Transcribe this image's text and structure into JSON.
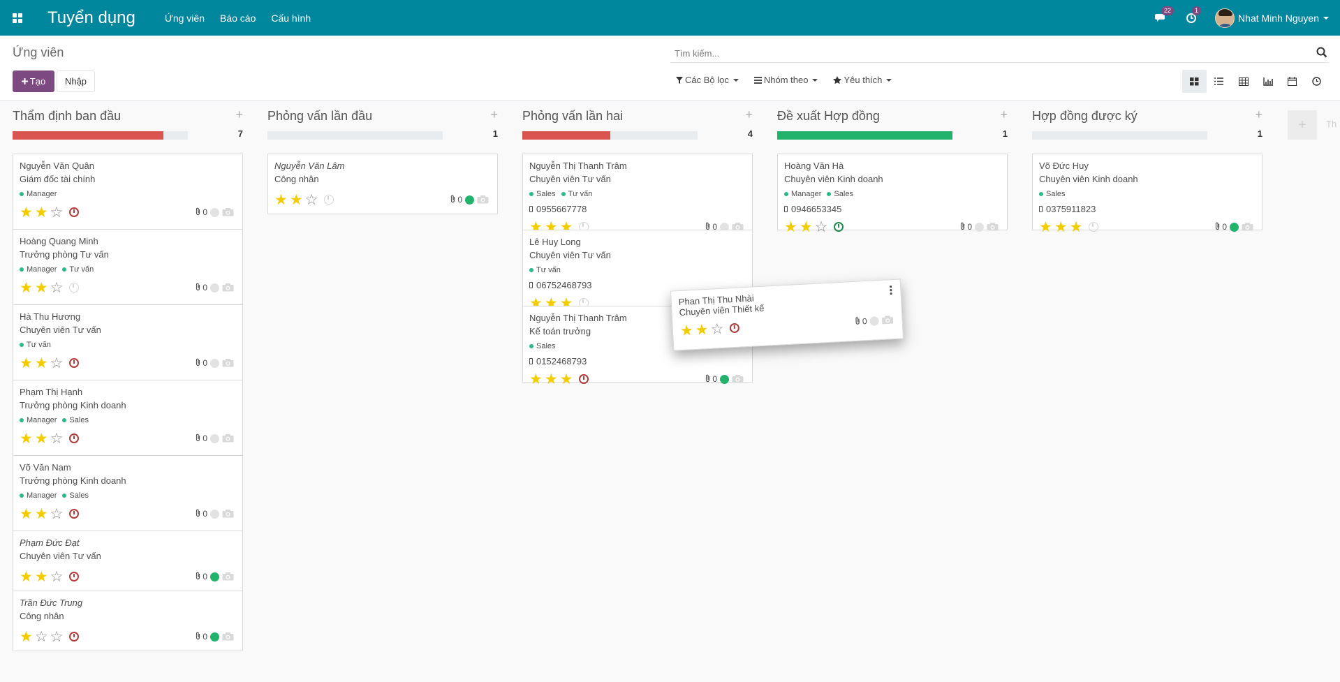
{
  "navbar": {
    "app_title": "Tuyển dụng",
    "menu": [
      "Ứng viên",
      "Báo cáo",
      "Cấu hình"
    ],
    "messages_count": "22",
    "activities_count": "1",
    "user_name": "Nhat Minh Nguyen"
  },
  "control": {
    "breadcrumb": "Ứng viên",
    "create_label": "Tạo",
    "import_label": "Nhập",
    "search_placeholder": "Tìm kiếm...",
    "filters_label": "Các Bộ lọc",
    "groupby_label": "Nhóm theo",
    "favorites_label": "Yêu thích"
  },
  "colors": {
    "navbar": "#00869d",
    "primary": "#7c4a80",
    "progress_red": "#d9534f",
    "progress_green": "#21b26b",
    "star": "#f3cc00",
    "tag_dot": "#2ab98b"
  },
  "columns": [
    {
      "title": "Thẩm định ban đầu",
      "count": "7",
      "progress": [
        {
          "color": "#d9534f",
          "percent": 86
        }
      ],
      "cards": [
        {
          "name": "Nguyễn Văn Quân",
          "italic": false,
          "job": "Giám đốc tài chính",
          "tags": [
            "Manager"
          ],
          "phone": "",
          "stars": 2,
          "activity": "red",
          "attachments": "0",
          "state": "grey"
        },
        {
          "name": "Hoàng Quang Minh",
          "italic": false,
          "job": "Trưởng phòng Tư vấn",
          "tags": [
            "Manager",
            "Tư vấn"
          ],
          "phone": "",
          "stars": 2,
          "activity": "grey",
          "attachments": "0",
          "state": "grey"
        },
        {
          "name": "Hà Thu Hương",
          "italic": false,
          "job": "Chuyên viên Tư vấn",
          "tags": [
            "Tư vấn"
          ],
          "phone": "",
          "stars": 2,
          "activity": "red",
          "attachments": "0",
          "state": "grey"
        },
        {
          "name": "Phạm Thị Hạnh",
          "italic": false,
          "job": "Trưởng phòng Kinh doanh",
          "tags": [
            "Manager",
            "Sales"
          ],
          "phone": "",
          "stars": 2,
          "activity": "red",
          "attachments": "0",
          "state": "grey"
        },
        {
          "name": "Võ Văn Nam",
          "italic": false,
          "job": "Trưởng phòng Kinh doanh",
          "tags": [
            "Manager",
            "Sales"
          ],
          "phone": "",
          "stars": 2,
          "activity": "red",
          "attachments": "0",
          "state": "grey"
        },
        {
          "name": "Phạm Đức Đạt",
          "italic": true,
          "job": "Chuyên viên Tư vấn",
          "tags": [],
          "phone": "",
          "stars": 2,
          "activity": "red",
          "attachments": "0",
          "state": "green"
        },
        {
          "name": "Trần Đức Trung",
          "italic": true,
          "job": "Công nhân",
          "tags": [],
          "phone": "",
          "stars": 1,
          "activity": "red",
          "attachments": "0",
          "state": "green"
        }
      ]
    },
    {
      "title": "Phỏng vấn lần đầu",
      "count": "1",
      "progress": [],
      "cards": [
        {
          "name": "Nguyễn Văn Lâm",
          "italic": true,
          "job": "Công nhân",
          "tags": [],
          "phone": "",
          "stars": 2,
          "activity": "grey",
          "attachments": "0",
          "state": "green"
        }
      ]
    },
    {
      "title": "Phỏng vấn lần hai",
      "count": "4",
      "progress": [
        {
          "color": "#d9534f",
          "percent": 50
        }
      ],
      "cards": [
        {
          "name": "Nguyễn Thị Thanh Trâm",
          "italic": false,
          "job": "Chuyên viên Tư vấn",
          "tags": [
            "Sales",
            "Tư vấn"
          ],
          "phone": "0955667778",
          "stars": 3,
          "activity": "grey",
          "attachments": "0",
          "state": "grey"
        },
        {
          "name": "Lê Huy Long",
          "italic": false,
          "job": "Chuyên viên Tư vấn",
          "tags": [
            "Tư vấn"
          ],
          "phone": "06752468793",
          "stars": 3,
          "activity": "grey",
          "attachments": "0",
          "state": "grey"
        },
        {
          "name": "Nguyễn Thị Thanh Trâm",
          "italic": false,
          "job": "Kế toán trưởng",
          "tags": [
            "Sales"
          ],
          "phone": "0152468793",
          "stars": 3,
          "activity": "red",
          "attachments": "0",
          "state": "green"
        }
      ]
    },
    {
      "title": "Đề xuất Hợp đồng",
      "count": "1",
      "progress": [
        {
          "color": "#21b26b",
          "percent": 100
        }
      ],
      "cards": [
        {
          "name": "Hoàng Văn Hà",
          "italic": false,
          "job": "Chuyên viên Kinh doanh",
          "tags": [
            "Manager",
            "Sales"
          ],
          "phone": "0946653345",
          "stars": 2,
          "activity": "green",
          "attachments": "0",
          "state": "grey"
        }
      ]
    },
    {
      "title": "Hợp đồng được ký",
      "count": "1",
      "progress": [],
      "cards": [
        {
          "name": "Võ Đức Huy",
          "italic": false,
          "job": "Chuyên viên Kinh doanh",
          "tags": [
            "Sales"
          ],
          "phone": "0375911823",
          "stars": 3,
          "activity": "grey",
          "attachments": "0",
          "state": "green"
        }
      ]
    }
  ],
  "dragged_card": {
    "name": "Phan Thị Thu Nhài",
    "italic": true,
    "job": "Chuyên viên Thiết kế",
    "stars": 2,
    "activity": "red",
    "attachments": "0",
    "state": "grey"
  },
  "ghost_column_label": "Th"
}
